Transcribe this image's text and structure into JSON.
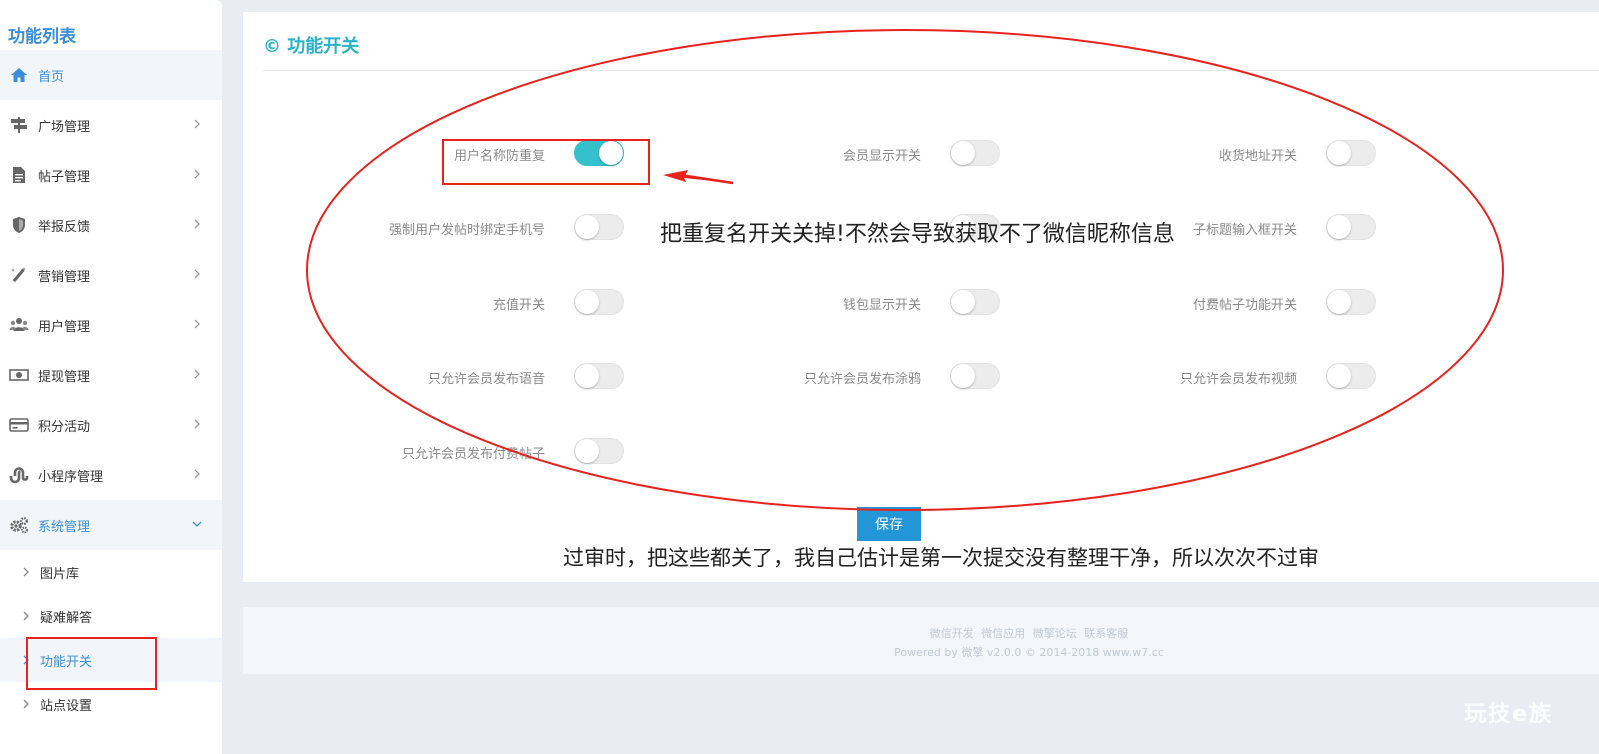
{
  "sidebar": {
    "title": "功能列表",
    "items": [
      {
        "label": "首页",
        "icon": "home-icon"
      },
      {
        "label": "广场管理",
        "icon": "signpost-icon"
      },
      {
        "label": "帖子管理",
        "icon": "document-icon"
      },
      {
        "label": "举报反馈",
        "icon": "shield-icon"
      },
      {
        "label": "营销管理",
        "icon": "magic-wand-icon"
      },
      {
        "label": "用户管理",
        "icon": "users-icon"
      },
      {
        "label": "提现管理",
        "icon": "money-icon"
      },
      {
        "label": "积分活动",
        "icon": "credit-card-icon"
      },
      {
        "label": "小程序管理",
        "icon": "stumbleupon-icon"
      },
      {
        "label": "系统管理",
        "icon": "gears-icon"
      }
    ],
    "sub_items": [
      {
        "label": "图片库"
      },
      {
        "label": "疑难解答"
      },
      {
        "label": "功能开关"
      },
      {
        "label": "站点设置"
      }
    ]
  },
  "panel": {
    "title": "© 功能开关",
    "options": [
      {
        "label": "用户名称防重复",
        "on": true
      },
      {
        "label": "会员显示开关",
        "on": false
      },
      {
        "label": "收货地址开关",
        "on": false
      },
      {
        "label": "强制用户发帖时绑定手机号",
        "on": false
      },
      {
        "label": "",
        "on": false
      },
      {
        "label": "子标题输入框开关",
        "on": false
      },
      {
        "label": "充值开关",
        "on": false
      },
      {
        "label": "钱包显示开关",
        "on": false
      },
      {
        "label": "付费帖子功能开关",
        "on": false
      },
      {
        "label": "只允许会员发布语音",
        "on": false
      },
      {
        "label": "只允许会员发布涂鸦",
        "on": false
      },
      {
        "label": "只允许会员发布视频",
        "on": false
      },
      {
        "label": "只允许会员发布付费帖子",
        "on": false
      }
    ],
    "save_label": "保存"
  },
  "footer": {
    "links": [
      "微信开发",
      "微信应用",
      "微擎论坛",
      "联系客服"
    ],
    "copyright": "Powered by 微擎 v2.0.0 © 2014-2018 www.w7.cc"
  },
  "annotations": {
    "note_1": "把重复名开关关掉!不然会导致获取不了微信昵称信息",
    "note_2": "过审时，把这些都关了，我自己估计是第一次提交没有整理干净，所以次次不过审"
  },
  "watermark": "玩技e族",
  "colors": {
    "accent": "#26b3c9",
    "sidebar_blue": "#3a8fd6",
    "toggle_on": "#35c0cd",
    "save_button": "#2296d6",
    "annotation_red": "#e8231d"
  }
}
